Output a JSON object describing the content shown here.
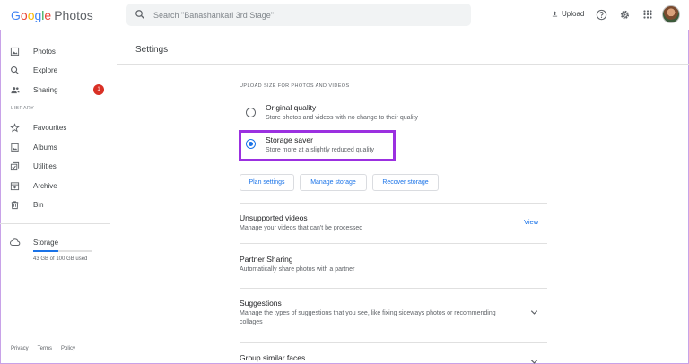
{
  "header": {
    "logo_google": [
      "G",
      "o",
      "o",
      "g",
      "l",
      "e"
    ],
    "logo_product": "Photos",
    "search_placeholder": "Search \"Banashankari 3rd Stage\"",
    "upload_label": "Upload"
  },
  "sidebar": {
    "items": [
      {
        "label": "Photos",
        "icon": "photo-icon"
      },
      {
        "label": "Explore",
        "icon": "search-icon"
      },
      {
        "label": "Sharing",
        "icon": "people-icon",
        "badge": "1"
      }
    ],
    "library_label": "LIBRARY",
    "library_items": [
      {
        "label": "Favourites",
        "icon": "star-icon"
      },
      {
        "label": "Albums",
        "icon": "album-icon"
      },
      {
        "label": "Utilities",
        "icon": "utilities-icon"
      },
      {
        "label": "Archive",
        "icon": "archive-icon"
      },
      {
        "label": "Bin",
        "icon": "trash-icon"
      }
    ],
    "storage": {
      "label": "Storage",
      "usage": "43 GB of 100 GB used",
      "fraction": 0.43
    },
    "footer": [
      "Privacy",
      "Terms",
      "Policy"
    ]
  },
  "main": {
    "title": "Settings",
    "upload_size_heading": "UPLOAD SIZE FOR PHOTOS AND VIDEOS",
    "options": [
      {
        "title": "Original quality",
        "desc": "Store photos and videos with no change to their quality",
        "selected": false
      },
      {
        "title": "Storage saver",
        "desc": "Store more at a slightly reduced quality",
        "selected": true
      }
    ],
    "buttons": [
      "Plan settings",
      "Manage storage",
      "Recover storage"
    ],
    "rows": [
      {
        "title": "Unsupported videos",
        "desc": "Manage your videos that can't be processed",
        "action": "View"
      },
      {
        "title": "Partner Sharing",
        "desc": "Automatically share photos with a partner"
      },
      {
        "title": "Suggestions",
        "desc": "Manage the types of suggestions that you see, like fixing sideways photos or recommending collages"
      },
      {
        "title": "Group similar faces"
      }
    ]
  },
  "colors": {
    "accent": "#1a73e8",
    "highlight": "#9b30e0",
    "badge": "#d93025"
  }
}
